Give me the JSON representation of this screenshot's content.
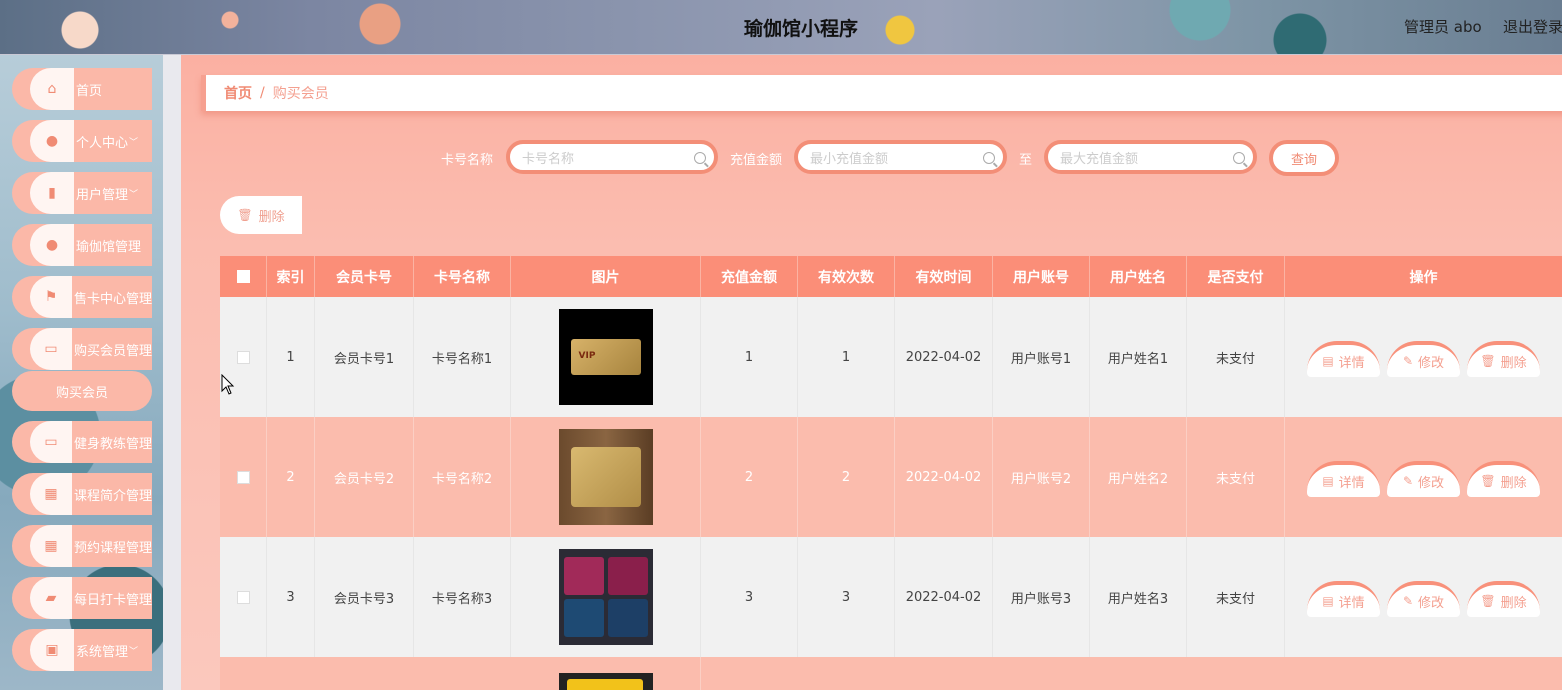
{
  "header": {
    "title": "瑜伽馆小程序",
    "admin": "管理员 abo",
    "logout": "退出登录"
  },
  "sidebar": {
    "items": [
      {
        "label": "首页",
        "icon": "home-icon"
      },
      {
        "label": "个人中心",
        "icon": "user-icon",
        "chevron": "﹀"
      },
      {
        "label": "用户管理",
        "icon": "clipboard-icon",
        "chevron": "﹀"
      },
      {
        "label": "瑜伽馆管理",
        "icon": "user-icon"
      },
      {
        "label": "售卡中心管理",
        "icon": "flag-icon"
      },
      {
        "label": "购买会员管理",
        "icon": "monitor-icon"
      },
      {
        "label": "健身教练管理",
        "icon": "monitor-icon"
      },
      {
        "label": "课程简介管理",
        "icon": "grid-icon"
      },
      {
        "label": "预约课程管理",
        "icon": "grid-icon"
      },
      {
        "label": "每日打卡管理",
        "icon": "chat-icon"
      },
      {
        "label": "系统管理",
        "icon": "briefcase-icon",
        "chevron": "﹀"
      }
    ],
    "sub_item": "购买会员"
  },
  "breadcrumb": {
    "home": "首页",
    "sep": "/",
    "current": "购买会员"
  },
  "search": {
    "card_name_label": "卡号名称",
    "card_name_placeholder": "卡号名称",
    "amount_label": "充值金额",
    "min_placeholder": "最小充值金额",
    "to_label": "至",
    "max_placeholder": "最大充值金额",
    "query_button": "查询"
  },
  "toolbar": {
    "delete_label": "删除"
  },
  "table": {
    "headers": [
      "索引",
      "会员卡号",
      "卡号名称",
      "图片",
      "充值金额",
      "有效次数",
      "有效时间",
      "用户账号",
      "用户姓名",
      "是否支付",
      "操作"
    ],
    "rows": [
      {
        "index": "1",
        "card_no": "会员卡号1",
        "card_name": "卡号名称1",
        "amount": "1",
        "times": "1",
        "date": "2022-04-02",
        "account": "用户账号1",
        "name": "用户姓名1",
        "paid": "未支付"
      },
      {
        "index": "2",
        "card_no": "会员卡号2",
        "card_name": "卡号名称2",
        "amount": "2",
        "times": "2",
        "date": "2022-04-02",
        "account": "用户账号2",
        "name": "用户姓名2",
        "paid": "未支付"
      },
      {
        "index": "3",
        "card_no": "会员卡号3",
        "card_name": "卡号名称3",
        "amount": "3",
        "times": "3",
        "date": "2022-04-02",
        "account": "用户账号3",
        "name": "用户姓名3",
        "paid": "未支付"
      }
    ],
    "actions": {
      "detail": "详情",
      "edit": "修改",
      "delete": "删除"
    }
  },
  "colors": {
    "accent": "#fb8e78",
    "light": "#fbbcad",
    "border": "#f38e77"
  }
}
